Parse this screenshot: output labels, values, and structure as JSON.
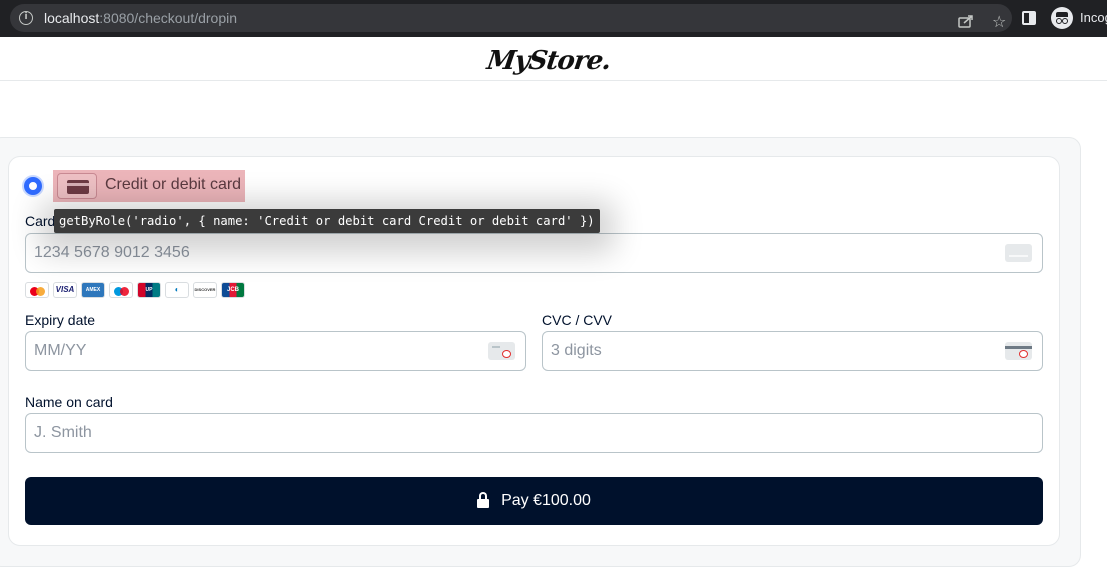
{
  "browser": {
    "url_host": "localhost",
    "url_path": ":8080/checkout/dropin",
    "profile_label": "Incog"
  },
  "store": {
    "logo_text": "MyStore."
  },
  "payment_method": {
    "label": "Credit or debit card",
    "selected": true
  },
  "tooltip": {
    "text": "getByRole('radio', { name: 'Credit or debit card Credit or debit card' })"
  },
  "form": {
    "card_number": {
      "label": "Card",
      "placeholder": "1234 5678 9012 3456",
      "value": ""
    },
    "brands": [
      "mastercard",
      "visa",
      "amex",
      "maestro",
      "unionpay",
      "diners",
      "discover",
      "jcb"
    ],
    "expiry": {
      "label": "Expiry date",
      "placeholder": "MM/YY",
      "value": ""
    },
    "cvc": {
      "label": "CVC / CVV",
      "placeholder": "3 digits",
      "value": ""
    },
    "holder_name": {
      "label": "Name on card",
      "placeholder": "J. Smith",
      "value": ""
    }
  },
  "pay_button": {
    "label": "Pay €100.00"
  },
  "colors": {
    "accent": "#2f6bff",
    "pay_button_bg": "#00112c",
    "highlight": "#dc7882",
    "chrome_bg": "#202124"
  }
}
